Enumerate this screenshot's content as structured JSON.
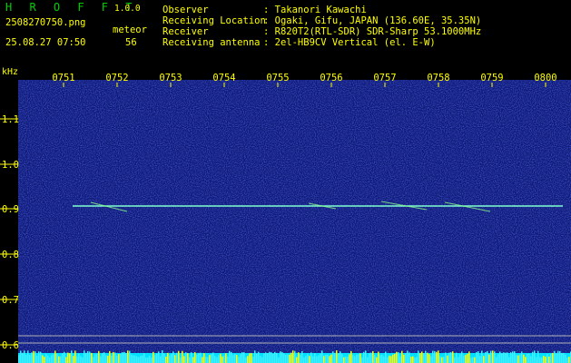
{
  "app": {
    "title": "H R O F F T",
    "version": "1.0.0"
  },
  "file": {
    "name": "2508270750.png",
    "datetime": "25.08.27 07:50"
  },
  "meteor": {
    "label": "meteor",
    "count": "56"
  },
  "info": [
    {
      "label": "Observer",
      "value": ": Takanori Kawachi"
    },
    {
      "label": "Receiving Location",
      "value": ": Ogaki, Gifu, JAPAN (136.60E, 35.35N)"
    },
    {
      "label": "Receiver",
      "value": ": R820T2(RTL-SDR) SDR-Sharp 53.1000MHz"
    },
    {
      "label": "Receiving antenna",
      "value": ": 2el-HB9CV Vertical (el. E-W)"
    }
  ],
  "axis": {
    "unit": "kHz",
    "time_ticks": [
      "0751",
      "0752",
      "0753",
      "0754",
      "0755",
      "0756",
      "0757",
      "0758",
      "0759",
      "0800"
    ],
    "freq_ticks": [
      "1.1",
      "1.0",
      "0.9",
      "0.8",
      "0.7",
      "0.6"
    ]
  },
  "colors": {
    "label_text": "#ffff00",
    "title": "#00d000",
    "carrier": "#7fffd0",
    "noise_bar": "#00e0ff"
  }
}
